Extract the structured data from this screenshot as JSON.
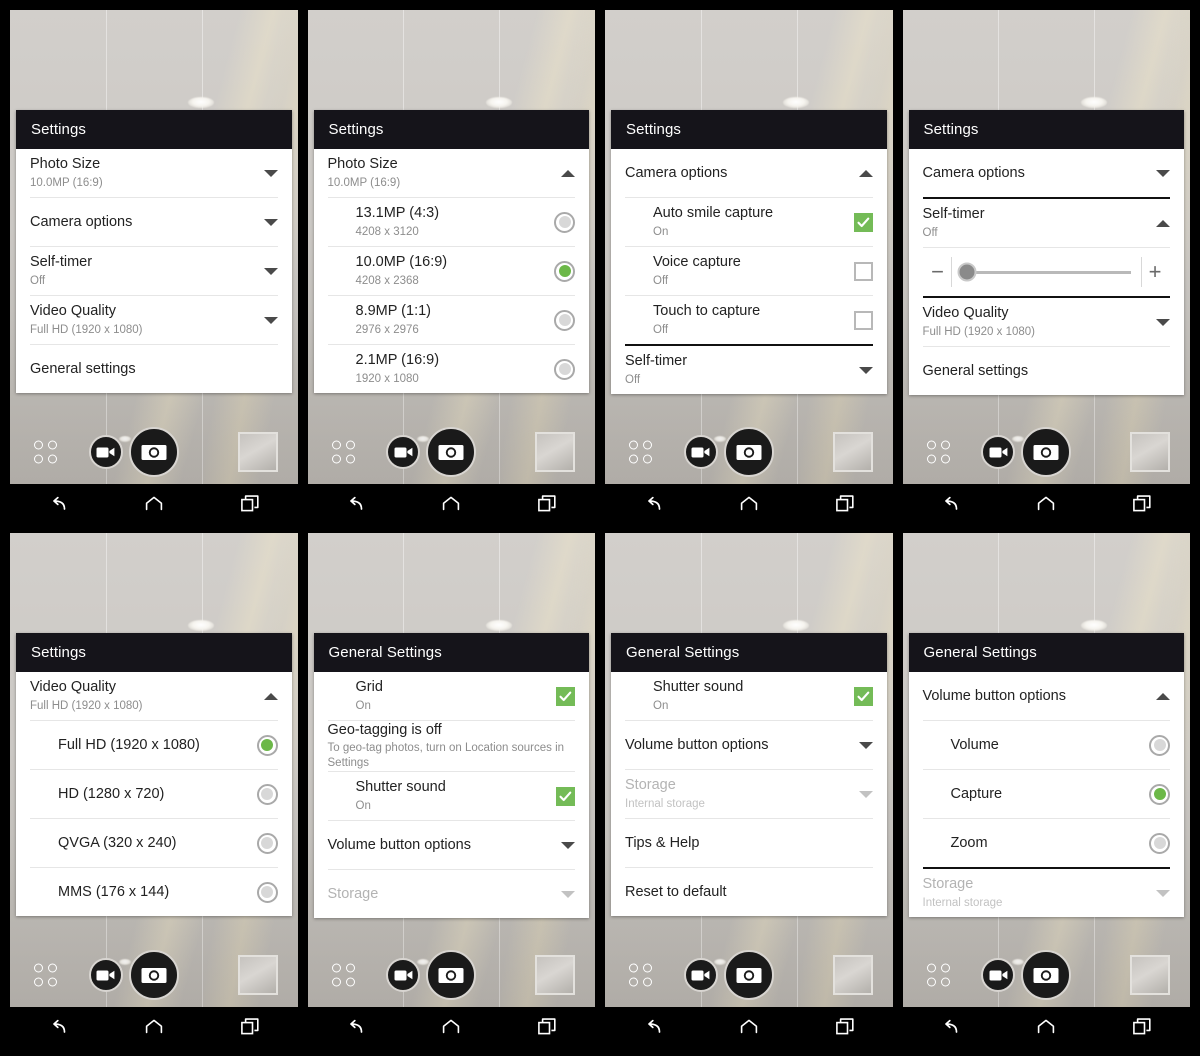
{
  "meta": {
    "app": "Camera",
    "nav": {
      "back": "back-icon",
      "home": "home-icon",
      "recents": "recents-icon"
    },
    "controls": {
      "modes": "modes-grid-icon",
      "video": "video-record-button",
      "shutter": "shutter-button",
      "gallery": "gallery-thumbnail"
    },
    "colors": {
      "header_bg": "#15141a",
      "card_bg": "#ffffff",
      "accent_green": "#6cb848",
      "checkbox_green": "#74bb57",
      "viewfinder_grey": "#c9c6c3",
      "text_primary": "#222222",
      "text_secondary": "#8d8d8d",
      "text_disabled": "#b3b3b3"
    }
  },
  "panels": [
    {
      "id": "panel-1-settings-root",
      "header": "Settings",
      "rows": [
        {
          "kind": "expander",
          "title": "Photo Size",
          "sub": "10.0MP (16:9)",
          "caret": "down"
        },
        {
          "kind": "expander",
          "title": "Camera options",
          "sub": "",
          "caret": "down"
        },
        {
          "kind": "expander",
          "title": "Self-timer",
          "sub": "Off",
          "caret": "down"
        },
        {
          "kind": "expander",
          "title": "Video Quality",
          "sub": "Full HD (1920 x 1080)",
          "caret": "down"
        },
        {
          "kind": "link",
          "title": "General settings",
          "sub": ""
        }
      ]
    },
    {
      "id": "panel-2-photo-size",
      "header": "Settings",
      "rows": [
        {
          "kind": "expander",
          "title": "Photo Size",
          "sub": "10.0MP (16:9)",
          "caret": "up"
        },
        {
          "kind": "radio",
          "title": "13.1MP (4:3)",
          "sub": "4208 x 3120",
          "selected": false
        },
        {
          "kind": "radio",
          "title": "10.0MP (16:9)",
          "sub": "4208 x 2368",
          "selected": true
        },
        {
          "kind": "radio",
          "title": "8.9MP (1:1)",
          "sub": "2976 x 2976",
          "selected": false
        },
        {
          "kind": "radio",
          "title": "2.1MP (16:9)",
          "sub": "1920 x 1080",
          "selected": false
        }
      ]
    },
    {
      "id": "panel-3-camera-options",
      "header": "Settings",
      "rows": [
        {
          "kind": "expander",
          "title": "Camera options",
          "sub": "",
          "caret": "up"
        },
        {
          "kind": "checkbox",
          "title": "Auto smile capture",
          "sub": "On",
          "checked": true
        },
        {
          "kind": "checkbox",
          "title": "Voice capture",
          "sub": "Off",
          "checked": false
        },
        {
          "kind": "checkbox",
          "title": "Touch to capture",
          "sub": "Off",
          "checked": false
        },
        {
          "kind": "expander",
          "title": "Self-timer",
          "sub": "Off",
          "caret": "down",
          "thick_above": true
        }
      ]
    },
    {
      "id": "panel-4-self-timer",
      "header": "Settings",
      "rows": [
        {
          "kind": "expander",
          "title": "Camera options",
          "sub": "",
          "caret": "down"
        },
        {
          "kind": "expander",
          "title": "Self-timer",
          "sub": "Off",
          "caret": "up",
          "thick_above": true
        },
        {
          "kind": "slider",
          "minus": "−",
          "plus": "+",
          "value_pct": 3
        },
        {
          "kind": "expander",
          "title": "Video Quality",
          "sub": "Full HD (1920 x 1080)",
          "caret": "down",
          "thick_above": true
        },
        {
          "kind": "link",
          "title": "General settings",
          "sub": ""
        }
      ]
    },
    {
      "id": "panel-5-video-quality",
      "header": "Settings",
      "rows": [
        {
          "kind": "expander",
          "title": "Video Quality",
          "sub": "Full HD (1920 x 1080)",
          "caret": "up"
        },
        {
          "kind": "radio",
          "title": "Full HD (1920 x 1080)",
          "sub": "",
          "selected": true
        },
        {
          "kind": "radio",
          "title": "HD (1280 x 720)",
          "sub": "",
          "selected": false
        },
        {
          "kind": "radio",
          "title": "QVGA (320 x 240)",
          "sub": "",
          "selected": false
        },
        {
          "kind": "radio",
          "title": "MMS (176 x 144)",
          "sub": "",
          "selected": false
        }
      ]
    },
    {
      "id": "panel-6-general-settings",
      "header": "General Settings",
      "rows": [
        {
          "kind": "checkbox",
          "title": "Grid",
          "sub": "On",
          "checked": true
        },
        {
          "kind": "info",
          "title": "Geo-tagging is off",
          "sub": "To geo-tag photos, turn on Location sources in Settings"
        },
        {
          "kind": "checkbox",
          "title": "Shutter sound",
          "sub": "On",
          "checked": true
        },
        {
          "kind": "expander",
          "title": "Volume button options",
          "sub": "",
          "caret": "down"
        },
        {
          "kind": "expander",
          "title": "Storage",
          "sub": "",
          "caret": "down",
          "disabled": true
        }
      ]
    },
    {
      "id": "panel-7-general-settings-scrolled",
      "header": "General Settings",
      "rows": [
        {
          "kind": "checkbox",
          "title": "Shutter sound",
          "sub": "On",
          "checked": true
        },
        {
          "kind": "expander",
          "title": "Volume button options",
          "sub": "",
          "caret": "down"
        },
        {
          "kind": "expander",
          "title": "Storage",
          "sub": "Internal storage",
          "caret": "down",
          "disabled": true
        },
        {
          "kind": "link",
          "title": "Tips & Help",
          "sub": ""
        },
        {
          "kind": "link",
          "title": "Reset to default",
          "sub": ""
        }
      ]
    },
    {
      "id": "panel-8-volume-button-options",
      "header": "General Settings",
      "rows": [
        {
          "kind": "expander",
          "title": "Volume button options",
          "sub": "",
          "caret": "up"
        },
        {
          "kind": "radio",
          "title": "Volume",
          "sub": "",
          "selected": false
        },
        {
          "kind": "radio",
          "title": "Capture",
          "sub": "",
          "selected": true
        },
        {
          "kind": "radio",
          "title": "Zoom",
          "sub": "",
          "selected": false
        },
        {
          "kind": "expander",
          "title": "Storage",
          "sub": "Internal storage",
          "caret": "down",
          "disabled": true,
          "thick_above": true
        }
      ]
    }
  ]
}
